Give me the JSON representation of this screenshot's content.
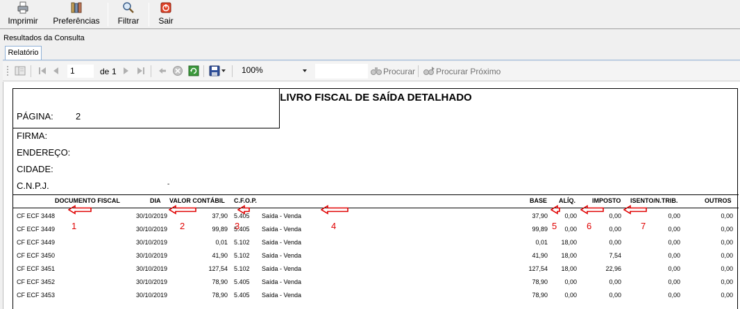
{
  "toolbar": {
    "items": [
      {
        "label": "Imprimir",
        "icon": "printer-icon"
      },
      {
        "label": "Preferências",
        "icon": "preferences-icon"
      },
      {
        "label": "Filtrar",
        "icon": "filter-magnifier-icon"
      },
      {
        "label": "Sair",
        "icon": "exit-icon"
      }
    ]
  },
  "results_label": "Resultados da Consulta",
  "tab_label": "Relatório",
  "report_toolbar": {
    "page_current": "1",
    "page_of": "de",
    "page_total": "1",
    "zoom": "100%",
    "find_label": "Procurar",
    "find_next_label": "Procurar Próximo"
  },
  "report": {
    "title": "LIVRO FISCAL DE SAÍDA DETALHADO",
    "page_label": "PÁGINA:",
    "page_number": "2",
    "firm_label": "FIRMA:",
    "address_label": "ENDEREÇO:",
    "city_label": "CIDADE:",
    "cnpj_label": "C.N.P.J.",
    "cnpj_value": "-",
    "columns": {
      "documento": "DOCUMENTO FISCAL",
      "dia": "DIA",
      "valor": "VALOR CONTÁBIL",
      "cfop": "C.F.O.P.",
      "base": "BASE",
      "aliq": "ALÍQ.",
      "imposto": "IMPOSTO",
      "isento": "ISENTO/N.TRIB.",
      "outros": "OUTROS"
    },
    "rows": [
      {
        "doc": "CF ECF 3448",
        "dia": "30/10/2019",
        "valor": "37,90",
        "cfop": "5.405",
        "desc": "Saída - Venda",
        "base": "37,90",
        "aliq": "0,00",
        "imposto": "0,00",
        "isento": "0,00",
        "outros": "0,00"
      },
      {
        "doc": "CF ECF 3449",
        "dia": "30/10/2019",
        "valor": "99,89",
        "cfop": "5.405",
        "desc": "Saída - Venda",
        "base": "99,89",
        "aliq": "0,00",
        "imposto": "0,00",
        "isento": "0,00",
        "outros": "0,00"
      },
      {
        "doc": "CF ECF 3449",
        "dia": "30/10/2019",
        "valor": "0,01",
        "cfop": "5.102",
        "desc": "Saída - Venda",
        "base": "0,01",
        "aliq": "18,00",
        "imposto": "0,00",
        "isento": "0,00",
        "outros": "0,00"
      },
      {
        "doc": "CF ECF 3450",
        "dia": "30/10/2019",
        "valor": "41,90",
        "cfop": "5.102",
        "desc": "Saída - Venda",
        "base": "41,90",
        "aliq": "18,00",
        "imposto": "7,54",
        "isento": "0,00",
        "outros": "0,00"
      },
      {
        "doc": "CF ECF 3451",
        "dia": "30/10/2019",
        "valor": "127,54",
        "cfop": "5.102",
        "desc": "Saída - Venda",
        "base": "127,54",
        "aliq": "18,00",
        "imposto": "22,96",
        "isento": "0,00",
        "outros": "0,00"
      },
      {
        "doc": "CF ECF 3452",
        "dia": "30/10/2019",
        "valor": "78,90",
        "cfop": "5.405",
        "desc": "Saída - Venda",
        "base": "78,90",
        "aliq": "0,00",
        "imposto": "0,00",
        "isento": "0,00",
        "outros": "0,00"
      },
      {
        "doc": "CF ECF 3453",
        "dia": "30/10/2019",
        "valor": "78,90",
        "cfop": "5.405",
        "desc": "Saída - Venda",
        "base": "78,90",
        "aliq": "0,00",
        "imposto": "0,00",
        "isento": "0,00",
        "outros": "0,00"
      }
    ]
  },
  "annotations": {
    "color": "#e00000",
    "numbers": [
      "1",
      "2",
      "3",
      "4",
      "5",
      "6",
      "7"
    ]
  }
}
